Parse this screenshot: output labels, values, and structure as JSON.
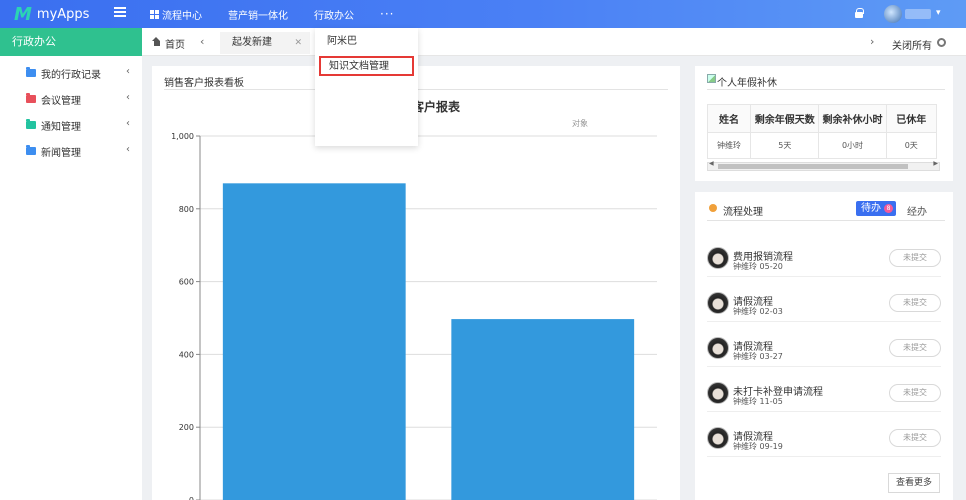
{
  "app": {
    "logo_mark": "M",
    "name": "myApps"
  },
  "topnav": {
    "items": [
      {
        "label": "流程中心"
      },
      {
        "label": "营产销一体化"
      },
      {
        "label": "行政办公"
      }
    ],
    "more": "···"
  },
  "sidebar": {
    "title": "行政办公",
    "items": [
      {
        "label": "我的行政记录",
        "color": "#3d8ef0"
      },
      {
        "label": "会议管理",
        "color": "#e8505b"
      },
      {
        "label": "通知管理",
        "color": "#23c3a0"
      },
      {
        "label": "新闻管理",
        "color": "#3d8ef0"
      }
    ]
  },
  "tabs": {
    "home": "首页",
    "active": "起发新建",
    "close_all": "关闭所有"
  },
  "dropdown": {
    "items": [
      {
        "label": "阿米巴"
      },
      {
        "label": "知识文档管理"
      }
    ]
  },
  "chart_panel": {
    "title": "销售客户报表看板"
  },
  "chart_data": {
    "type": "bar",
    "title": "客户报表",
    "subtitle": "对象",
    "categories": [
      "",
      ""
    ],
    "values": [
      870,
      497
    ],
    "ylim": [
      0,
      1000
    ],
    "yticks": [
      "0",
      "200",
      "400",
      "600",
      "800",
      "1,000"
    ],
    "grid": true,
    "bar_color": "#3399dd"
  },
  "leave_panel": {
    "title": "个人年假补休",
    "columns": [
      "姓名",
      "剩余年假天数",
      "剩余补休小时",
      "已休年"
    ],
    "rows": [
      [
        "钟维玲",
        "5天",
        "0小时",
        "0天"
      ]
    ]
  },
  "flow_panel": {
    "title": "流程处理",
    "todo_label": "待办",
    "todo_badge": "8",
    "done_label": "经办",
    "items": [
      {
        "name": "费用报销流程",
        "meta": "钟维玲 05-20",
        "status": "未提交"
      },
      {
        "name": "请假流程",
        "meta": "钟维玲 02-03",
        "status": "未提交"
      },
      {
        "name": "请假流程",
        "meta": "钟维玲 03-27",
        "status": "未提交"
      },
      {
        "name": "未打卡补登申请流程",
        "meta": "钟维玲 11-05",
        "status": "未提交"
      },
      {
        "name": "请假流程",
        "meta": "钟维玲 09-19",
        "status": "未提交"
      }
    ],
    "view_more": "查看更多"
  }
}
